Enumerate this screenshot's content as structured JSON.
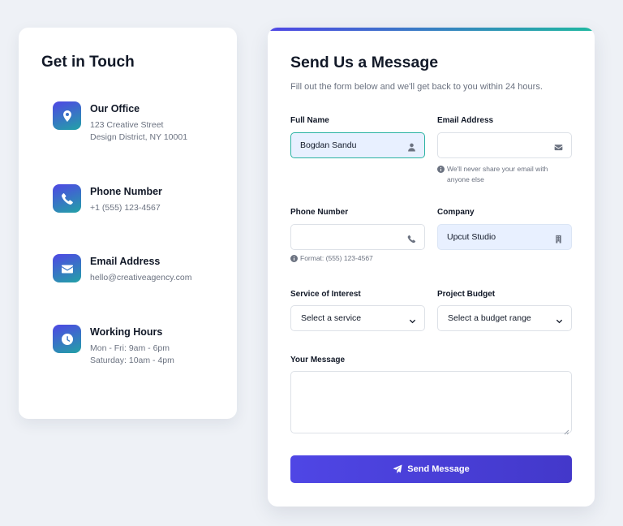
{
  "contact": {
    "title": "Get in Touch",
    "items": [
      {
        "icon": "location-pin-icon",
        "label": "Our Office",
        "lines": [
          "123 Creative Street",
          "Design District, NY 10001"
        ]
      },
      {
        "icon": "phone-icon",
        "label": "Phone Number",
        "lines": [
          "+1 (555) 123-4567"
        ]
      },
      {
        "icon": "envelope-icon",
        "label": "Email Address",
        "lines": [
          "hello@creativeagency.com"
        ]
      },
      {
        "icon": "clock-icon",
        "label": "Working Hours",
        "lines": [
          "Mon - Fri: 9am - 6pm",
          "Saturday: 10am - 4pm"
        ]
      }
    ]
  },
  "form": {
    "title": "Send Us a Message",
    "subtitle": "Fill out the form below and we'll get back to you within 24 hours.",
    "full_name": {
      "label": "Full Name",
      "value": "Bogdan Sandu",
      "icon": "user-icon"
    },
    "email": {
      "label": "Email Address",
      "value": "",
      "icon": "envelope-icon",
      "hint": "We'll never share your email with anyone else"
    },
    "phone": {
      "label": "Phone Number",
      "value": "",
      "icon": "phone-icon",
      "hint": "Format: (555) 123-4567"
    },
    "company": {
      "label": "Company",
      "value": "Upcut Studio",
      "icon": "building-icon"
    },
    "service": {
      "label": "Service of Interest",
      "selected": "Select a service"
    },
    "budget": {
      "label": "Project Budget",
      "selected": "Select a budget range"
    },
    "message": {
      "label": "Your Message",
      "value": ""
    },
    "submit": {
      "label": "Send Message",
      "icon": "paper-plane-icon"
    }
  },
  "colors": {
    "accent": "#4f46e5",
    "teal": "#1fb8a0",
    "background": "#eef1f6"
  }
}
